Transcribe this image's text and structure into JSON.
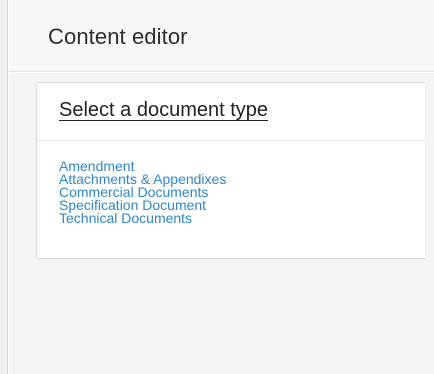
{
  "header": {
    "title": "Content editor"
  },
  "panel": {
    "title": "Select a document type",
    "document_types": [
      "Amendment",
      "Attachments & Appendixes",
      "Commercial Documents",
      "Specification Document",
      "Technical Documents"
    ]
  },
  "colors": {
    "link": "#2f86c8",
    "header_bg": "#f7f7f7",
    "content_bg": "#f4f4f4"
  }
}
